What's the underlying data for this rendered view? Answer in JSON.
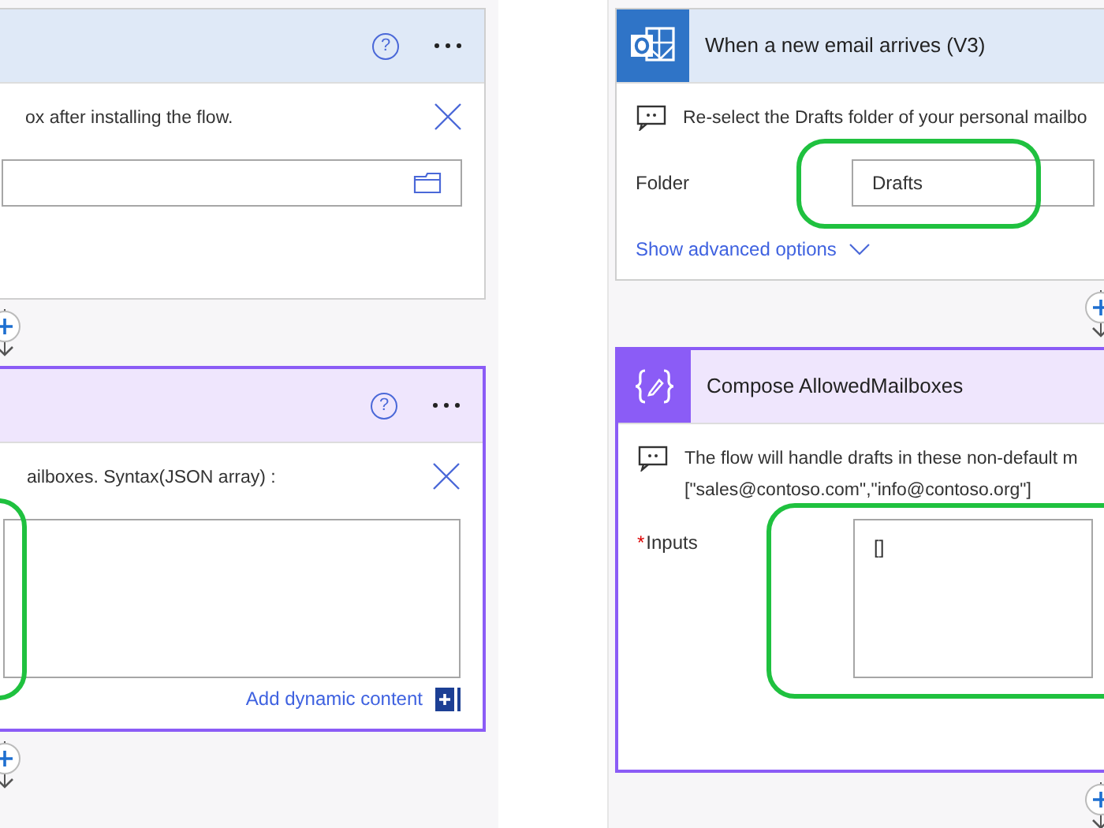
{
  "panes": [
    {
      "cards": [
        {
          "kind": "trigger",
          "header_actions": true,
          "help_glyph": "?",
          "note_lines": [
            "ox after installing the flow."
          ],
          "dismissible": true,
          "fields": [
            {
              "kind": "folder",
              "highlighted": false
            }
          ]
        },
        {
          "kind": "action",
          "header_actions": true,
          "help_glyph": "?",
          "note_lines": [
            "ailboxes. Syntax(JSON array) :"
          ],
          "dismissible": true,
          "fields": [
            {
              "kind": "multiline",
              "highlighted": true
            }
          ],
          "link": {
            "kind": "dynamic",
            "text": "Add dynamic content"
          }
        }
      ]
    },
    {
      "cards": [
        {
          "kind": "trigger",
          "header_actions": false,
          "title": "When a new email arrives (V3)",
          "note_lines": [
            "Re-select the Drafts folder of your personal mailbo"
          ],
          "dismissible": false,
          "fields": [
            {
              "kind": "text",
              "label": "Folder",
              "value": "Drafts",
              "highlighted": true
            }
          ],
          "link": {
            "kind": "advanced",
            "text": "Show advanced options"
          }
        },
        {
          "kind": "action",
          "header_actions": false,
          "title": "Compose AllowedMailboxes",
          "note_lines": [
            "The flow will handle drafts in these non-default m",
            "[\"sales@contoso.com\",\"info@contoso.org\"]"
          ],
          "dismissible": false,
          "fields": [
            {
              "kind": "multiline",
              "label": "Inputs",
              "required_mark": "*",
              "value": "[]",
              "highlighted": true
            }
          ]
        }
      ]
    }
  ]
}
